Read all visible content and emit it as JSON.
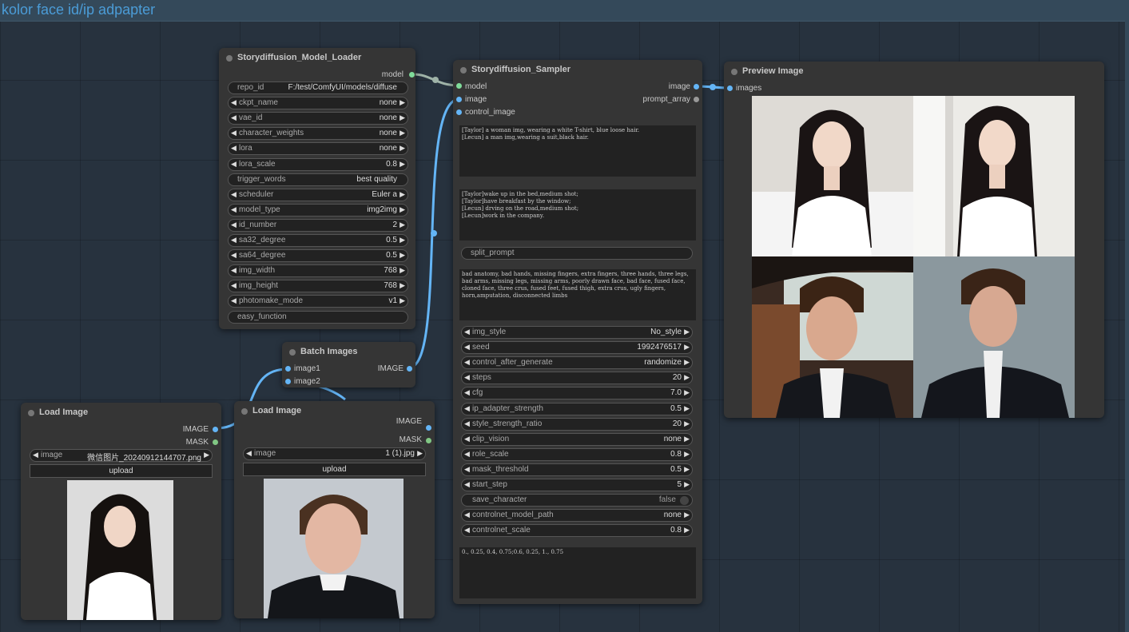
{
  "group": {
    "title": "kolor face id/ip adpapter"
  },
  "model_loader": {
    "title": "Storydiffusion_Model_Loader",
    "output_model": "model",
    "widgets": [
      {
        "label": "repo_id",
        "value": "F:/test/ComfyUI/models/diffuse",
        "kind": "text"
      },
      {
        "label": "ckpt_name",
        "value": "none",
        "kind": "combo"
      },
      {
        "label": "vae_id",
        "value": "none",
        "kind": "combo"
      },
      {
        "label": "character_weights",
        "value": "none",
        "kind": "combo"
      },
      {
        "label": "lora",
        "value": "none",
        "kind": "combo"
      },
      {
        "label": "lora_scale",
        "value": "0.8",
        "kind": "combo"
      },
      {
        "label": "trigger_words",
        "value": "best quality",
        "kind": "text"
      },
      {
        "label": "scheduler",
        "value": "Euler a",
        "kind": "combo"
      },
      {
        "label": "model_type",
        "value": "img2img",
        "kind": "combo"
      },
      {
        "label": "id_number",
        "value": "2",
        "kind": "combo"
      },
      {
        "label": "sa32_degree",
        "value": "0.5",
        "kind": "combo"
      },
      {
        "label": "sa64_degree",
        "value": "0.5",
        "kind": "combo"
      },
      {
        "label": "img_width",
        "value": "768",
        "kind": "combo"
      },
      {
        "label": "img_height",
        "value": "768",
        "kind": "combo"
      },
      {
        "label": "photomake_mode",
        "value": "v1",
        "kind": "combo"
      },
      {
        "label": "easy_function",
        "value": "",
        "kind": "text"
      }
    ]
  },
  "sampler": {
    "title": "Storydiffusion_Sampler",
    "inputs": [
      "model",
      "image",
      "control_image"
    ],
    "outputs": [
      "image",
      "prompt_array"
    ],
    "character_prompt": "[Taylor] a woman img, wearing a white T-shirt, blue loose hair.\n[Lecun] a man img,wearing a suit,black hair.",
    "scene_prompt": "[Taylor]wake up in the bed,medium shot;\n[Taylor]have breakfast by the window;\n[Lecun] drving on the road,medium shot;\n[Lecun]work in the company.",
    "split_prompt": "split_prompt",
    "negative_prompt": "bad anatomy, bad hands, missing fingers, extra fingers, three hands, three legs, bad arms, missing legs, missing arms, poorly drawn face, bad face, fused face, cloned face, three crus, fused feet, fused thigh, extra crus, ugly fingers, horn,amputation, disconnected limbs",
    "widgets": [
      {
        "label": "img_style",
        "value": "No_style",
        "kind": "combo"
      },
      {
        "label": "seed",
        "value": "1992476517",
        "kind": "combo"
      },
      {
        "label": "control_after_generate",
        "value": "randomize",
        "kind": "combo"
      },
      {
        "label": "steps",
        "value": "20",
        "kind": "combo"
      },
      {
        "label": "cfg",
        "value": "7.0",
        "kind": "combo"
      },
      {
        "label": "ip_adapter_strength",
        "value": "0.5",
        "kind": "combo"
      },
      {
        "label": "style_strength_ratio",
        "value": "20",
        "kind": "combo"
      },
      {
        "label": "clip_vision",
        "value": "none",
        "kind": "combo"
      },
      {
        "label": "role_scale",
        "value": "0.8",
        "kind": "combo"
      },
      {
        "label": "mask_threshold",
        "value": "0.5",
        "kind": "combo"
      },
      {
        "label": "start_step",
        "value": "5",
        "kind": "combo"
      },
      {
        "label": "save_character",
        "value": "false",
        "kind": "toggle"
      },
      {
        "label": "controlnet_model_path",
        "value": "none",
        "kind": "combo"
      },
      {
        "label": "controlnet_scale",
        "value": "0.8",
        "kind": "combo"
      }
    ],
    "guidance_list": "0., 0.25, 0.4, 0.75;0.6, 0.25, 1., 0.75"
  },
  "preview": {
    "title": "Preview Image",
    "input": "images"
  },
  "batch": {
    "title": "Batch Images",
    "inputs": [
      "image1",
      "image2"
    ],
    "output": "IMAGE"
  },
  "load1": {
    "title": "Load Image",
    "outputs": [
      "IMAGE",
      "MASK"
    ],
    "image_label": "image",
    "image_value": "微信图片_20240912144707.png",
    "upload": "upload"
  },
  "load2": {
    "title": "Load Image",
    "outputs": [
      "IMAGE",
      "MASK"
    ],
    "image_label": "image",
    "image_value": "1 (1).jpg",
    "upload": "upload"
  },
  "colors": {
    "canvas": "#27323e",
    "group": "#34495a",
    "group_title": "#4b9cd7",
    "node": "#353535",
    "wire_image": "#64b5f6",
    "wire_model": "#b0c4b8"
  }
}
